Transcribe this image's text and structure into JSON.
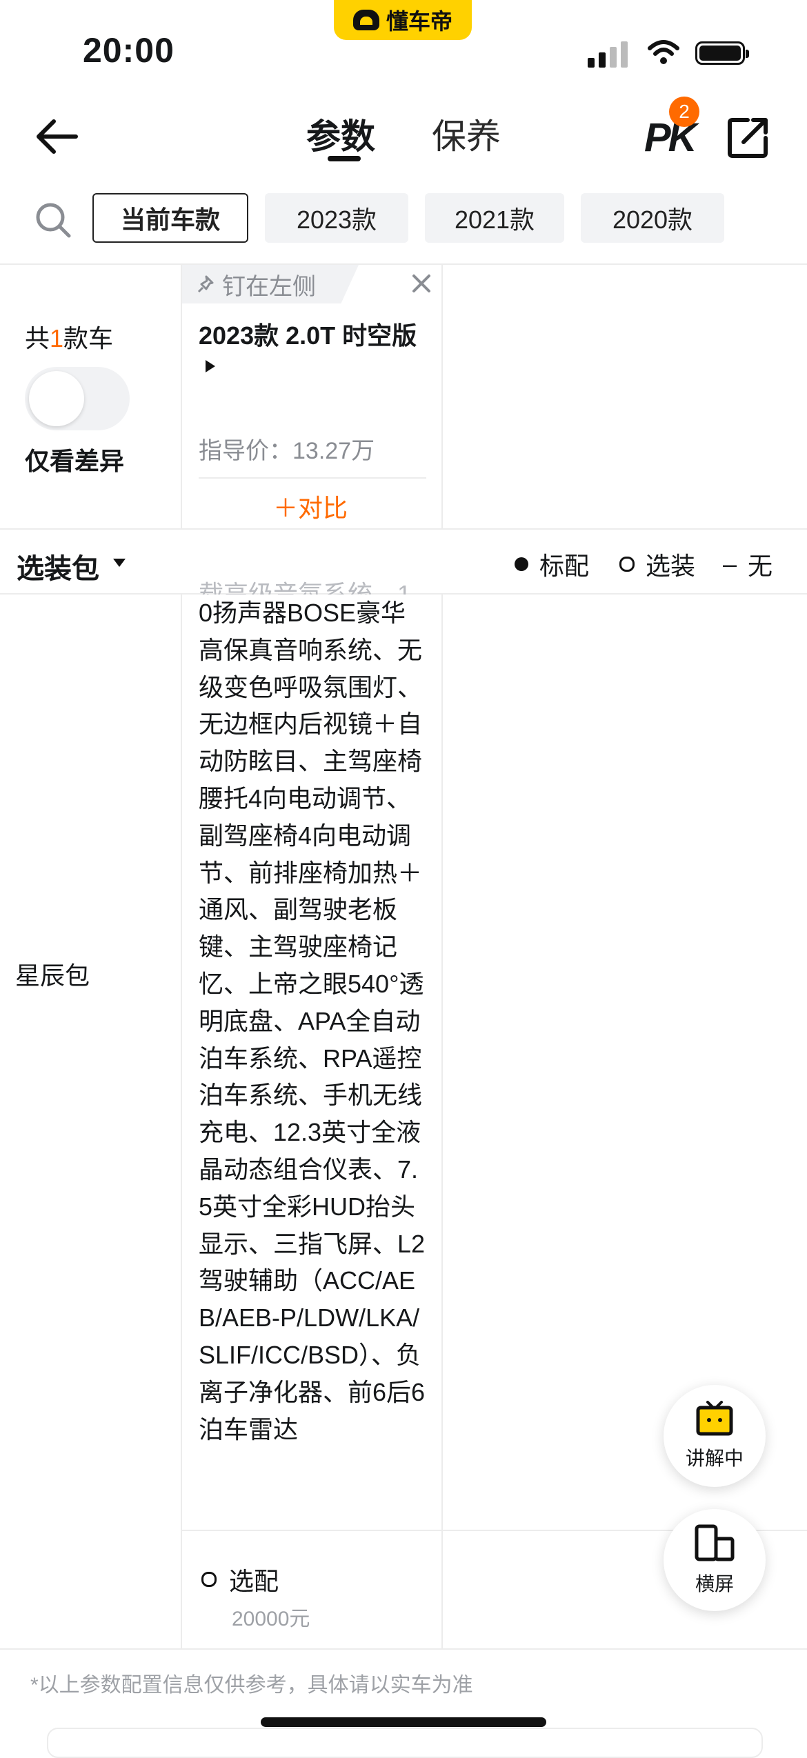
{
  "status_bar": {
    "time": "20:00",
    "app_name": "懂车帝"
  },
  "header": {
    "tabs": [
      {
        "label": "参数"
      },
      {
        "label": "保养"
      }
    ],
    "pk_label": "PK",
    "pk_badge": "2"
  },
  "year_filters": [
    {
      "label": "当前车款",
      "active": true
    },
    {
      "label": "2023款",
      "active": false
    },
    {
      "label": "2021款",
      "active": false
    },
    {
      "label": "2020款",
      "active": false
    }
  ],
  "left_panel": {
    "count_prefix": "共",
    "count_num": "1",
    "count_suffix": "款车",
    "diff_toggle_label": "仅看差异",
    "diff_toggle_on": false
  },
  "car_card": {
    "pin_label": "钉在左侧",
    "name": "2023款 2.0T 时空版",
    "guide_price": "指导价：13.27万",
    "compare_label": "＋对比"
  },
  "options_bar": {
    "title": "选装包",
    "legend": {
      "standard": "标配",
      "optional": "选装",
      "none_dash": "–",
      "none": "无"
    }
  },
  "package": {
    "label": "星辰包",
    "cut_line": "载高级音氛系统、1",
    "description": "0扬声器BOSE豪华高保真音响系统、无级变色呼吸氛围灯、无边框内后视镜＋自动防眩目、主驾座椅腰托4向电动调节、副驾座椅4向电动调节、前排座椅加热＋通风、副驾驶老板键、主驾驶座椅记忆、上帝之眼540°透明底盘、APA全自动泊车系统、RPA遥控泊车系统、手机无线充电、12.3英寸全液晶动态组合仪表、7.5英寸全彩HUD抬头显示、三指飞屏、L2驾驶辅助（ACC/AEB/AEB-P/LDW/LKA/SLIF/ICC/BSD）、负离子净化器、前6后6泊车雷达",
    "option_status": "选配",
    "option_price": "20000元"
  },
  "footnote": "*以上参数配置信息仅供参考，具体请以实车为准",
  "floating": {
    "explain_label": "讲解中",
    "landscape_label": "横屏"
  },
  "colors": {
    "accent_orange": "#ff6a00",
    "brand_yellow": "#ffd100"
  }
}
